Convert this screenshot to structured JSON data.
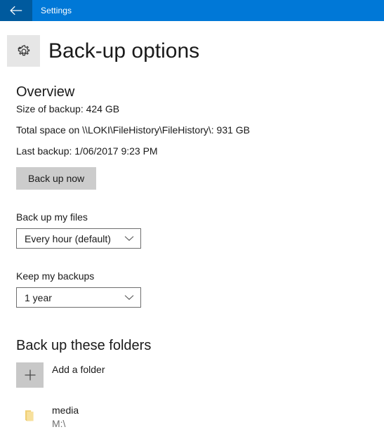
{
  "titlebar": {
    "back_icon": "back-arrow-icon",
    "title": "Settings"
  },
  "header": {
    "icon": "gear-icon",
    "title": "Back-up options"
  },
  "overview": {
    "heading": "Overview",
    "size_of_backup": "Size of backup: 424 GB",
    "total_space": "Total space on \\\\LOKI\\FileHistory\\FileHistory\\: 931 GB",
    "last_backup": "Last backup: 1/06/2017 9:23 PM",
    "backup_now_label": "Back up now"
  },
  "backup_frequency": {
    "label": "Back up my files",
    "value": "Every hour (default)",
    "chevron_icon": "chevron-down-icon"
  },
  "keep_backups": {
    "label": "Keep my backups",
    "value": "1 year",
    "chevron_icon": "chevron-down-icon"
  },
  "folders": {
    "heading": "Back up these folders",
    "add_label": "Add a folder",
    "add_icon": "plus-icon",
    "items": [
      {
        "name": "media",
        "path": "M:\\",
        "icon": "folder-icon"
      }
    ]
  },
  "colors": {
    "titlebar_blue": "#0078d7",
    "back_button_blue": "#005a9e",
    "button_gray": "#cccccc",
    "icon_block_gray": "#e6e6e6",
    "folder_yellow": "#f2d57e"
  }
}
